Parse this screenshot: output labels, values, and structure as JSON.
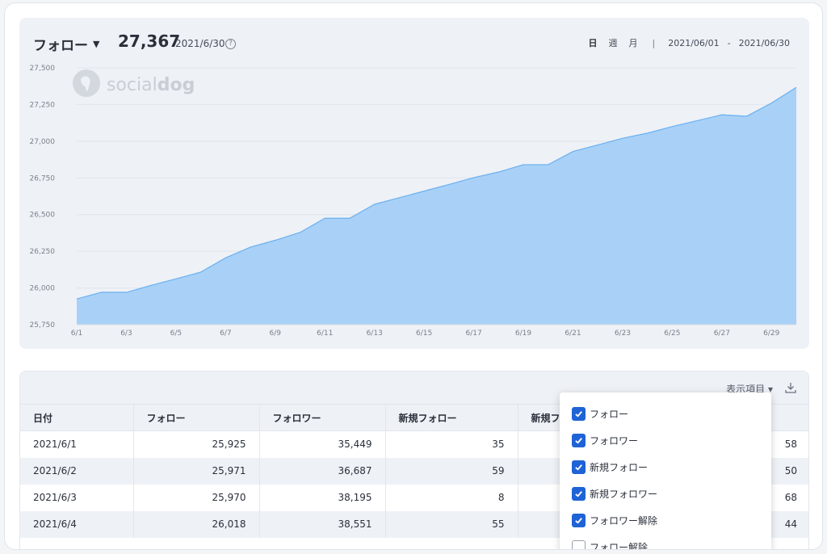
{
  "header": {
    "metric_label": "フォロー",
    "current_value": "27,367",
    "current_date": "2021/6/30",
    "granularity": [
      "日",
      "週",
      "月"
    ],
    "active_granularity": "日",
    "date_from": "2021/06/01",
    "date_to": "2021/06/30",
    "range_sep": "-"
  },
  "watermark": {
    "light": "social",
    "bold": "dog"
  },
  "chart_data": {
    "type": "area",
    "x": [
      "6/1",
      "6/2",
      "6/3",
      "6/4",
      "6/5",
      "6/6",
      "6/7",
      "6/8",
      "6/9",
      "6/10",
      "6/11",
      "6/12",
      "6/13",
      "6/14",
      "6/15",
      "6/16",
      "6/17",
      "6/18",
      "6/19",
      "6/20",
      "6/21",
      "6/22",
      "6/23",
      "6/24",
      "6/25",
      "6/26",
      "6/27",
      "6/28",
      "6/29",
      "6/30"
    ],
    "values": [
      25925,
      25971,
      25970,
      26018,
      26062,
      26108,
      26205,
      26278,
      26325,
      26378,
      26475,
      26475,
      26570,
      26615,
      26660,
      26705,
      26752,
      26790,
      26840,
      26840,
      26930,
      26975,
      27020,
      27055,
      27100,
      27140,
      27180,
      27170,
      27260,
      27367
    ],
    "xticks": [
      "6/1",
      "6/3",
      "6/5",
      "6/7",
      "6/9",
      "6/11",
      "6/13",
      "6/15",
      "6/17",
      "6/19",
      "6/21",
      "6/23",
      "6/25",
      "6/27",
      "6/29"
    ],
    "yticks": [
      "25,750",
      "26,000",
      "26,250",
      "26,500",
      "26,750",
      "27,000",
      "27,250",
      "27,500"
    ],
    "ylim": [
      25750,
      27500
    ],
    "color": "#6ab0f0",
    "fill": "#a9d1f7",
    "grid": true
  },
  "table": {
    "toolbar": {
      "display_items": "表示項目 ▾"
    },
    "columns": [
      "日付",
      "フォロー",
      "フォロワー",
      "新規フォロー",
      "新規フ",
      "",
      ""
    ],
    "rows": [
      {
        "date": "2021/6/1",
        "follow": "25,925",
        "follower": "35,449",
        "new_follow": "35",
        "last": "58"
      },
      {
        "date": "2021/6/2",
        "follow": "25,971",
        "follower": "36,687",
        "new_follow": "59",
        "last": "50"
      },
      {
        "date": "2021/6/3",
        "follow": "25,970",
        "follower": "38,195",
        "new_follow": "8",
        "last": "68"
      },
      {
        "date": "2021/6/4",
        "follow": "26,018",
        "follower": "38,551",
        "new_follow": "55",
        "last": "44"
      }
    ]
  },
  "dropdown": {
    "items": [
      {
        "label": "フォロー",
        "checked": true
      },
      {
        "label": "フォロワー",
        "checked": true
      },
      {
        "label": "新規フォロー",
        "checked": true
      },
      {
        "label": "新規フォロワー",
        "checked": true
      },
      {
        "label": "フォロワー解除",
        "checked": true
      },
      {
        "label": "フォロー解除",
        "checked": false
      }
    ]
  }
}
